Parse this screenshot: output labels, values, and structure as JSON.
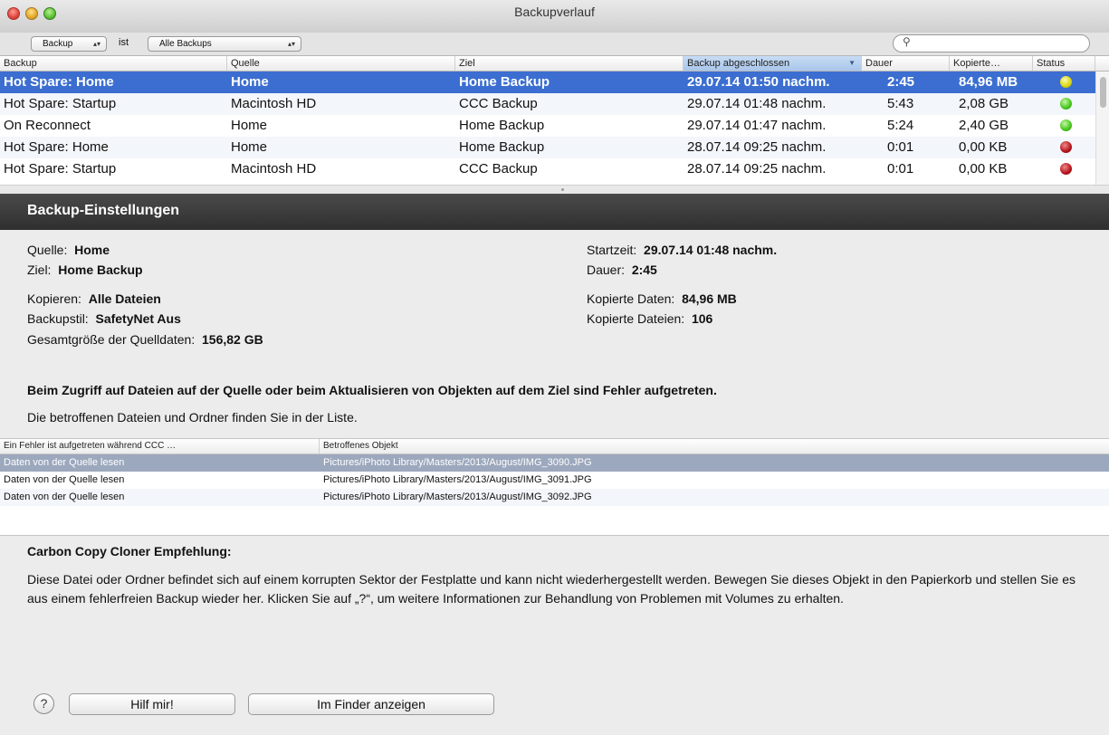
{
  "window": {
    "title": "Backupverlauf"
  },
  "filter": {
    "field_label": "Backup",
    "operator_label": "ist",
    "value_label": "Alle Backups",
    "search_placeholder": ""
  },
  "table": {
    "columns": [
      "Backup",
      "Quelle",
      "Ziel",
      "Backup abgeschlossen",
      "Dauer",
      "Kopierte…",
      "Status"
    ],
    "sorted_column": "Backup abgeschlossen",
    "rows": [
      {
        "backup": "Hot Spare: Home",
        "quelle": "Home",
        "ziel": "Home Backup",
        "abgeschlossen": "29.07.14 01:50 nachm.",
        "dauer": "2:45",
        "kopiert": "84,96 MB",
        "status": "yellow",
        "selected": true
      },
      {
        "backup": "Hot Spare: Startup",
        "quelle": "Macintosh HD",
        "ziel": "CCC Backup",
        "abgeschlossen": "29.07.14 01:48 nachm.",
        "dauer": "5:43",
        "kopiert": "2,08 GB",
        "status": "green",
        "selected": false
      },
      {
        "backup": "On Reconnect",
        "quelle": "Home",
        "ziel": "Home Backup",
        "abgeschlossen": "29.07.14 01:47 nachm.",
        "dauer": "5:24",
        "kopiert": "2,40 GB",
        "status": "green",
        "selected": false
      },
      {
        "backup": "Hot Spare: Home",
        "quelle": "Home",
        "ziel": "Home Backup",
        "abgeschlossen": "28.07.14 09:25 nachm.",
        "dauer": "0:01",
        "kopiert": "0,00 KB",
        "status": "red",
        "selected": false
      },
      {
        "backup": "Hot Spare: Startup",
        "quelle": "Macintosh HD",
        "ziel": "CCC Backup",
        "abgeschlossen": "28.07.14 09:25 nachm.",
        "dauer": "0:01",
        "kopiert": "0,00 KB",
        "status": "red",
        "selected": false
      }
    ],
    "status_colors": {
      "yellow": "#d8d40f",
      "green": "#43c41a",
      "red": "#b3121a"
    }
  },
  "settings": {
    "header": "Backup-Einstellungen",
    "quelle_label": "Quelle:",
    "quelle_value": "Home",
    "ziel_label": "Ziel:",
    "ziel_value": "Home Backup",
    "kopieren_label": "Kopieren:",
    "kopieren_value": "Alle Dateien",
    "backupstil_label": "Backupstil:",
    "backupstil_value": "SafetyNet Aus",
    "gesamt_label": "Gesamtgröße der Quelldaten:",
    "gesamt_value": "156,82 GB",
    "startzeit_label": "Startzeit:",
    "startzeit_value": "29.07.14 01:48 nachm.",
    "dauer_label": "Dauer:",
    "dauer_value": "2:45",
    "daten_label": "Kopierte Daten:",
    "daten_value": "84,96 MB",
    "dateien_label": "Kopierte Dateien:",
    "dateien_value": "106"
  },
  "errors": {
    "title": "Beim Zugriff auf Dateien auf der Quelle oder beim Aktualisieren von Objekten auf dem Ziel sind Fehler aufgetreten.",
    "subtitle": "Die betroffenen Dateien und Ordner finden Sie in der Liste.",
    "columns": [
      "Ein Fehler ist aufgetreten während CCC …",
      "Betroffenes Objekt"
    ],
    "rows": [
      {
        "error": "Daten von der Quelle lesen",
        "object": "Pictures/iPhoto Library/Masters/2013/August/IMG_3090.JPG",
        "selected": true
      },
      {
        "error": "Daten von der Quelle lesen",
        "object": "Pictures/iPhoto Library/Masters/2013/August/IMG_3091.JPG",
        "selected": false
      },
      {
        "error": "Daten von der Quelle lesen",
        "object": "Pictures/iPhoto Library/Masters/2013/August/IMG_3092.JPG",
        "selected": false
      }
    ]
  },
  "recommendation": {
    "title": "Carbon Copy Cloner Empfehlung:",
    "text": "Diese Datei oder Ordner befindet sich auf einem korrupten Sektor der Festplatte und kann nicht wiederhergestellt werden. Bewegen Sie dieses Objekt in den Papierkorb und stellen Sie es aus einem fehlerfreien Backup wieder her. Klicken Sie auf „?“, um weitere Informationen zur Behandlung von Problemen mit Volumes zu erhalten."
  },
  "buttons": {
    "help_icon": "?",
    "help_label": "Hilf mir!",
    "finder_label": "Im Finder anzeigen"
  }
}
